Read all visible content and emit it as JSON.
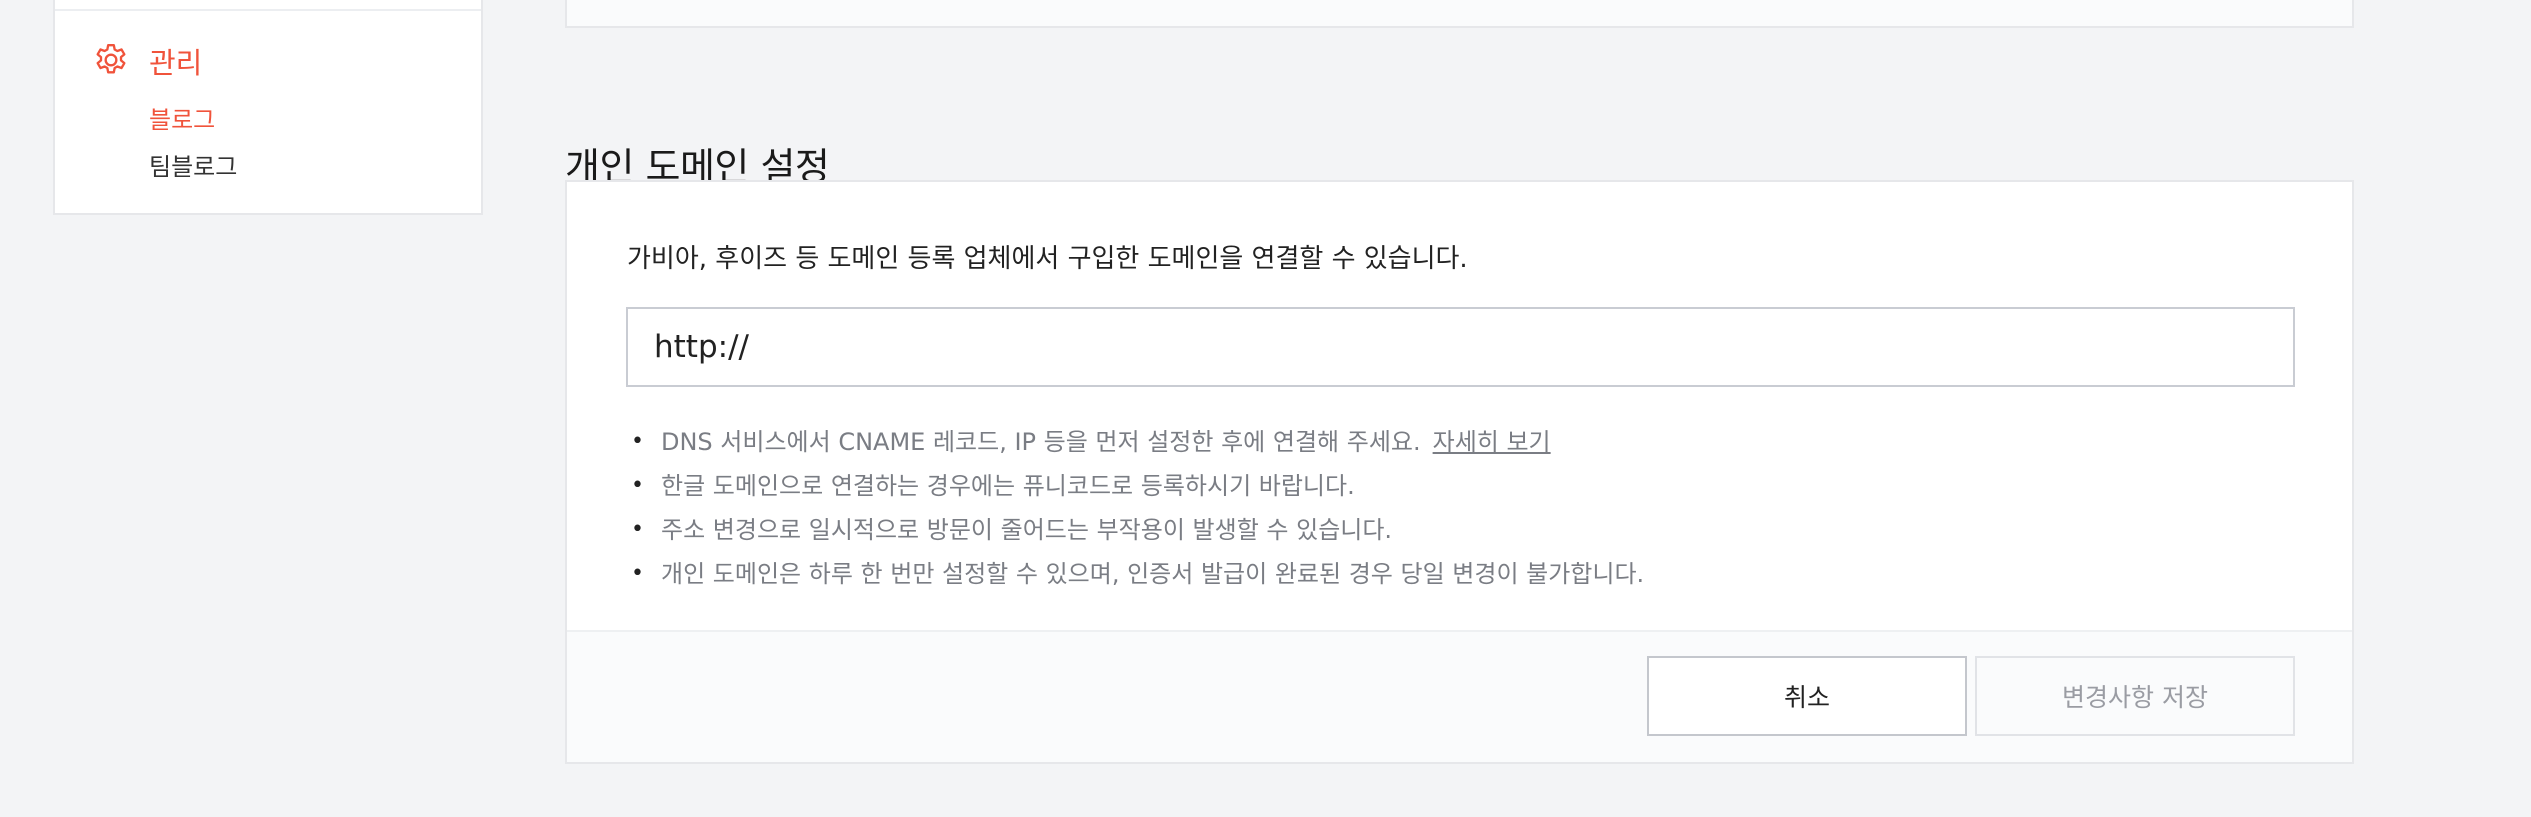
{
  "sidebar": {
    "manage_icon": "gear-icon",
    "manage_label": "관리",
    "items": [
      {
        "label": "블로그",
        "active": true
      },
      {
        "label": "팀블로그",
        "active": false
      }
    ]
  },
  "section": {
    "title": "개인 도메인 설정"
  },
  "card": {
    "description": "가비아, 후이즈 등 도메인 등록 업체에서 구입한 도메인을 연결할 수 있습니다.",
    "domain_input": {
      "value": "",
      "placeholder": "http://"
    },
    "notes": [
      "DNS 서비스에서 CNAME 레코드, IP 등을 먼저 설정한 후에 연결해 주세요.",
      "한글 도메인으로 연결하는 경우에는 퓨니코드로 등록하시기 바랍니다.",
      "주소 변경으로 일시적으로 방문이 줄어드는 부작용이 발생할 수 있습니다.",
      "개인 도메인은 하루 한 번만 설정할 수 있으며, 인증서 발급이 완료된 경우 당일 변경이 불가합니다."
    ],
    "more_link": "자세히 보기",
    "buttons": {
      "cancel": "취소",
      "save": "변경사항 저장"
    }
  },
  "colors": {
    "accent": "#f0533b",
    "background": "#f3f4f6",
    "muted_text": "#7a7d84"
  }
}
